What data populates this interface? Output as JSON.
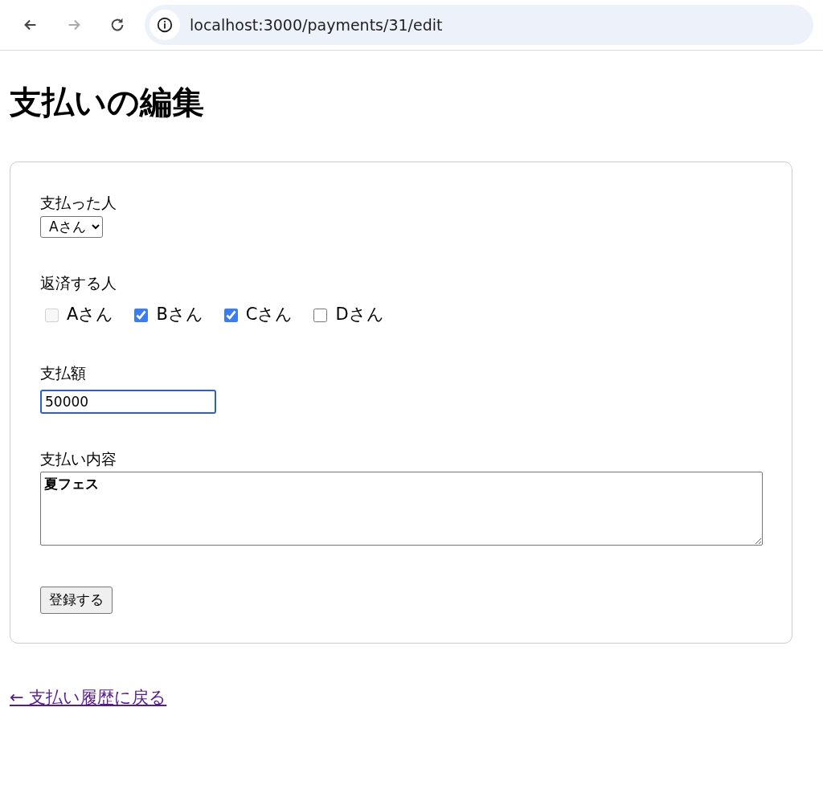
{
  "browser": {
    "back_enabled": true,
    "forward_enabled": false,
    "url": "localhost:3000/payments/31/edit"
  },
  "title": "支払いの編集",
  "form": {
    "payer": {
      "label": "支払った人",
      "value": "Aさん"
    },
    "debtors": {
      "label": "返済する人",
      "options": [
        {
          "label": "Aさん",
          "checked": false,
          "disabled": true
        },
        {
          "label": "Bさん",
          "checked": true,
          "disabled": false
        },
        {
          "label": "Cさん",
          "checked": true,
          "disabled": false
        },
        {
          "label": "Dさん",
          "checked": false,
          "disabled": false
        }
      ]
    },
    "amount": {
      "label": "支払額",
      "value": "50000",
      "focused": true
    },
    "description": {
      "label": "支払い内容",
      "value": "夏フェス"
    },
    "submit": "登録する"
  },
  "back_link": "← 支払い履歴に戻る"
}
